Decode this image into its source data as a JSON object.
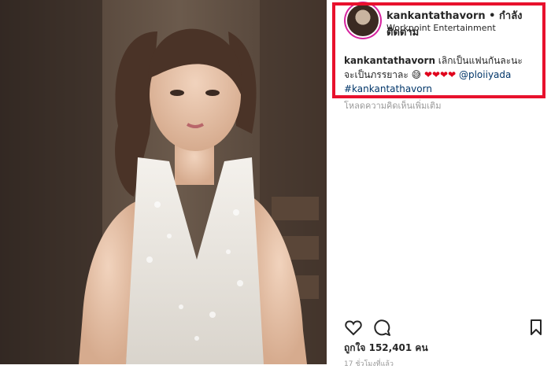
{
  "post": {
    "username": "kankantathavorn",
    "separator": " • ",
    "follow_label": "กำลังติดตาม",
    "subtitle": "Workpoint Entertainment",
    "caption": {
      "author": "kankantathavorn",
      "text_line1": " เลิกเป็นแฟนกันละนะ",
      "text_line2": "จะเป็นภรรยาละ ",
      "emoji": "😅",
      "hearts": "❤❤❤❤",
      "mention": "@ploiiyada",
      "hashtag": "#kankantathavorn"
    },
    "load_more": "โหลดความคิดเห็นเพิ่มเติม",
    "likes_label": "ถูกใจ 152,401 คน",
    "time_label": "17 ชั่วโมงที่แล้ว"
  },
  "icons": {
    "like": "heart-icon",
    "comment": "comment-icon",
    "save": "bookmark-icon"
  },
  "colors": {
    "highlight_box": "#e8112d",
    "link": "#003569",
    "heart": "#e0001b"
  }
}
